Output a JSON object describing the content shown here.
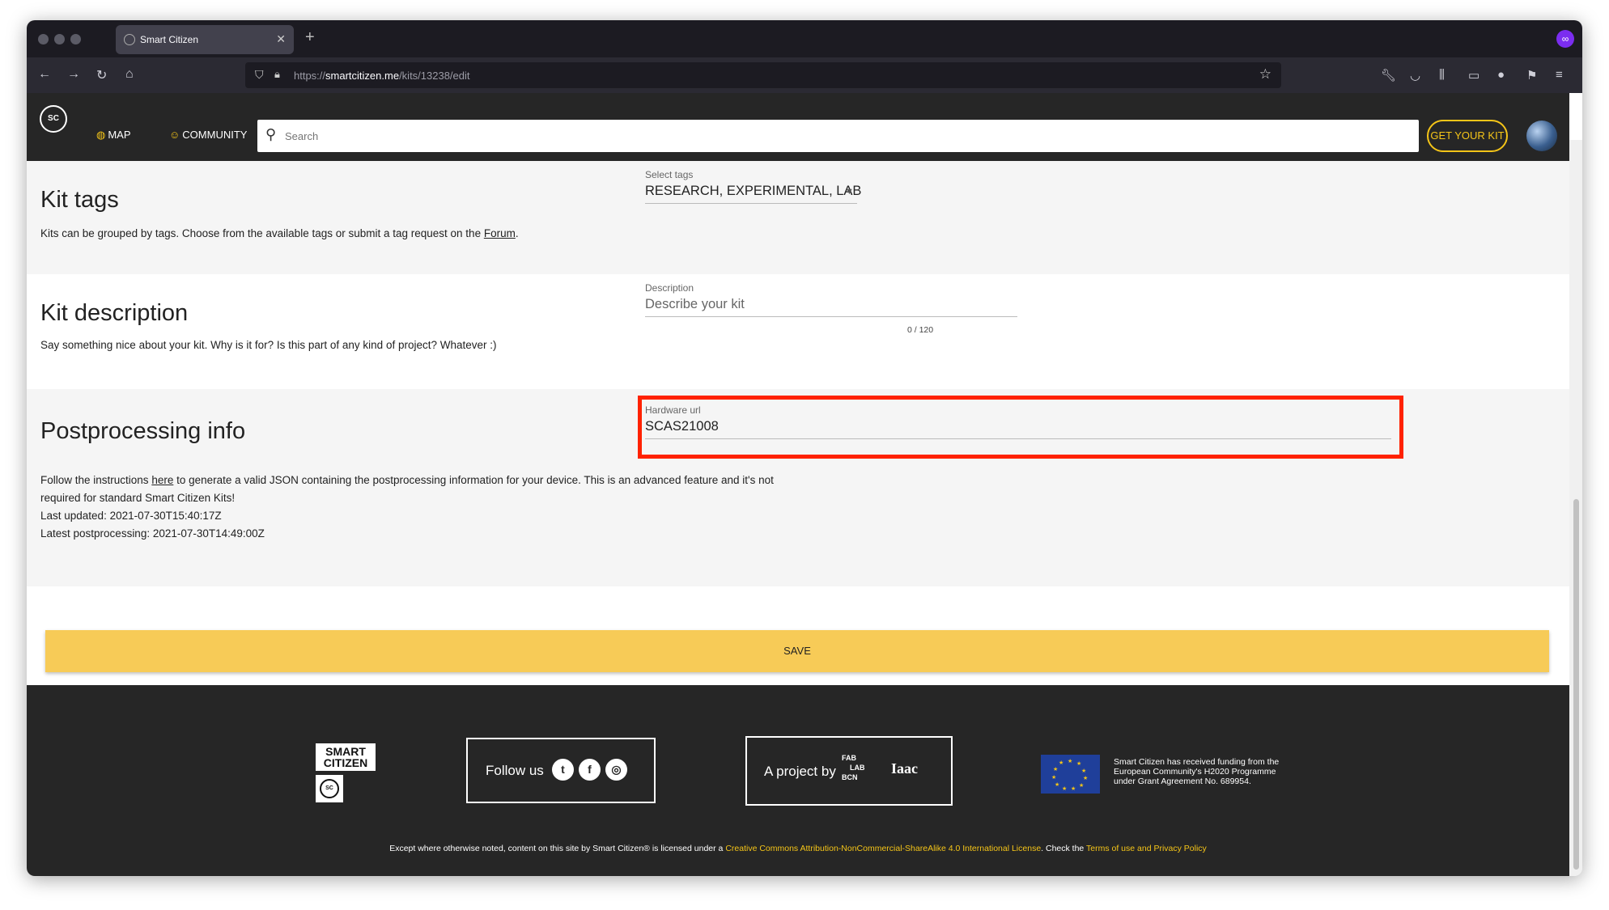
{
  "browser": {
    "tab_title": "Smart Citizen",
    "url_prefix": "https://",
    "url_domain": "smartcitizen.me",
    "url_path": "/kits/13238/edit",
    "new_tab": "+"
  },
  "header": {
    "map_label": "MAP",
    "community_label": "COMMUNITY",
    "search_placeholder": "Search",
    "get_kit_label": "GET YOUR KIT",
    "logo_text": "SC"
  },
  "sections": {
    "tags": {
      "title": "Kit tags",
      "text_before": "Kits can be grouped by tags. Choose from the available tags or submit a tag request on the ",
      "link": "Forum",
      "text_after": ".",
      "field_label": "Select tags",
      "field_value": "RESEARCH, EXPERIMENTAL, LAB"
    },
    "description": {
      "title": "Kit description",
      "text": "Say something nice about your kit. Why is it for? Is this part of any kind of project? Whatever :)",
      "field_label": "Description",
      "field_placeholder": "Describe your kit",
      "counter": "0 / 120"
    },
    "postprocessing": {
      "title": "Postprocessing info",
      "text_before": "Follow the instructions ",
      "link": "here",
      "text_after": " to generate a valid JSON containing the postprocessing information for your device. This is an advanced feature and it's not",
      "text_line2": "required for standard Smart Citizen Kits!",
      "last_updated": "Last updated: 2021-07-30T15:40:17Z",
      "latest_postprocessing": "Latest postprocessing: 2021-07-30T14:49:00Z",
      "field_label": "Hardware url",
      "field_value": "SCAS21008"
    }
  },
  "save_label": "SAVE",
  "footer": {
    "logo_line1": "SMART",
    "logo_line2": "CITIZEN",
    "follow_us": "Follow us",
    "project_by": "A project by",
    "fablab_1": "FAB",
    "fablab_2": "LAB",
    "fablab_3": "BCN",
    "iaac": "Iaac",
    "eu_line1": "Smart Citizen has received funding from the",
    "eu_line2": "European Community's H2020 Programme",
    "eu_line3": "under Grant Agreement No. 689954.",
    "license_prefix": "Except where otherwise noted, content on this site by Smart Citizen® is licensed under a ",
    "license_link": "Creative Commons Attribution-NonCommercial-ShareAlike 4.0 International License",
    "license_mid": ". Check the ",
    "terms_link": "Terms of use and Privacy Policy"
  },
  "colors": {
    "accent": "#f5c518",
    "save_button": "#f7cb57",
    "highlight": "#ff2200",
    "header_bg": "#262626"
  }
}
